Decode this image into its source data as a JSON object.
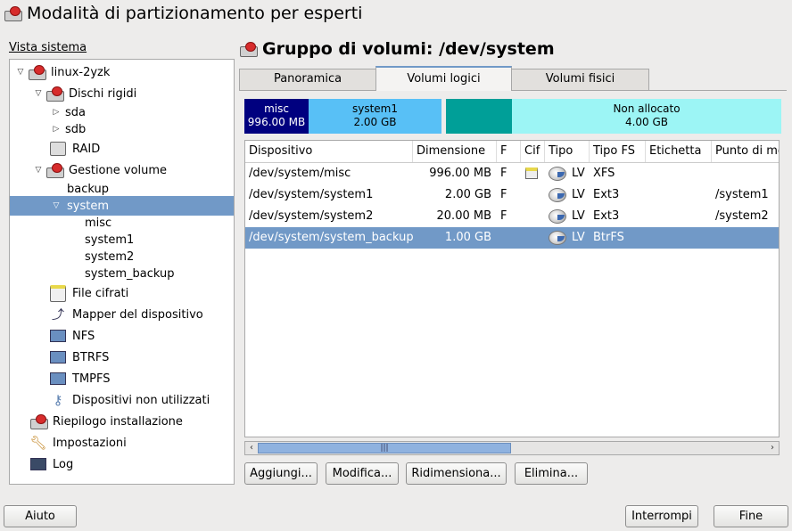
{
  "window": {
    "title": "Modalità di partizionamento per esperti"
  },
  "tree": {
    "label": "Vista sistema",
    "items": [
      {
        "label": "linux-2yzk"
      },
      {
        "label": "Dischi rigidi"
      },
      {
        "label": "sda"
      },
      {
        "label": "sdb"
      },
      {
        "label": "RAID"
      },
      {
        "label": "Gestione volume"
      },
      {
        "label": "backup"
      },
      {
        "label": "system"
      },
      {
        "label": "misc"
      },
      {
        "label": "system1"
      },
      {
        "label": "system2"
      },
      {
        "label": "system_backup"
      },
      {
        "label": "File cifrati"
      },
      {
        "label": "Mapper del dispositivo"
      },
      {
        "label": "NFS"
      },
      {
        "label": "BTRFS"
      },
      {
        "label": "TMPFS"
      },
      {
        "label": "Dispositivi non utilizzati"
      },
      {
        "label": "Riepilogo installazione"
      },
      {
        "label": "Impostazioni"
      },
      {
        "label": "Log"
      }
    ]
  },
  "main": {
    "title": "Gruppo di volumi: /dev/system",
    "tabs": [
      {
        "label": "Panoramica"
      },
      {
        "label": "Volumi logici"
      },
      {
        "label": "Volumi fisici"
      }
    ],
    "bar": [
      {
        "name": "misc",
        "size": "996.00 MB",
        "color": "#00007f"
      },
      {
        "name": "system1",
        "size": "2.00 GB",
        "color": "#58c0f6"
      },
      {
        "name": "",
        "size": "",
        "color": "#009f98"
      },
      {
        "name": "Non allocato",
        "size": "4.00 GB",
        "color": "#9cf5f5"
      }
    ],
    "table": {
      "columns": [
        "Dispositivo",
        "Dimensione",
        "F",
        "Cif",
        "Tipo",
        "Tipo FS",
        "Etichetta",
        "Punto di mo"
      ],
      "rows": [
        {
          "device": "/dev/system/misc",
          "size": "996.00 MB",
          "f": "F",
          "type": "LV",
          "fs": "XFS",
          "mount": ""
        },
        {
          "device": "/dev/system/system1",
          "size": "2.00 GB",
          "f": "F",
          "type": "LV",
          "fs": "Ext3",
          "mount": "/system1"
        },
        {
          "device": "/dev/system/system2",
          "size": "20.00 MB",
          "f": "F",
          "type": "LV",
          "fs": "Ext3",
          "mount": "/system2"
        },
        {
          "device": "/dev/system/system_backup",
          "size": "1.00 GB",
          "f": "",
          "type": "LV",
          "fs": "BtrFS",
          "mount": ""
        }
      ]
    },
    "buttons": {
      "add": "Aggiungi...",
      "edit": "Modifica...",
      "resize": "Ridimensiona...",
      "delete": "Elimina..."
    }
  },
  "footer": {
    "help": "Aiuto",
    "abort": "Interrompi",
    "finish": "Fine"
  },
  "colors": {
    "selection": "#7199c7",
    "accent_red": "#d72c2c"
  }
}
